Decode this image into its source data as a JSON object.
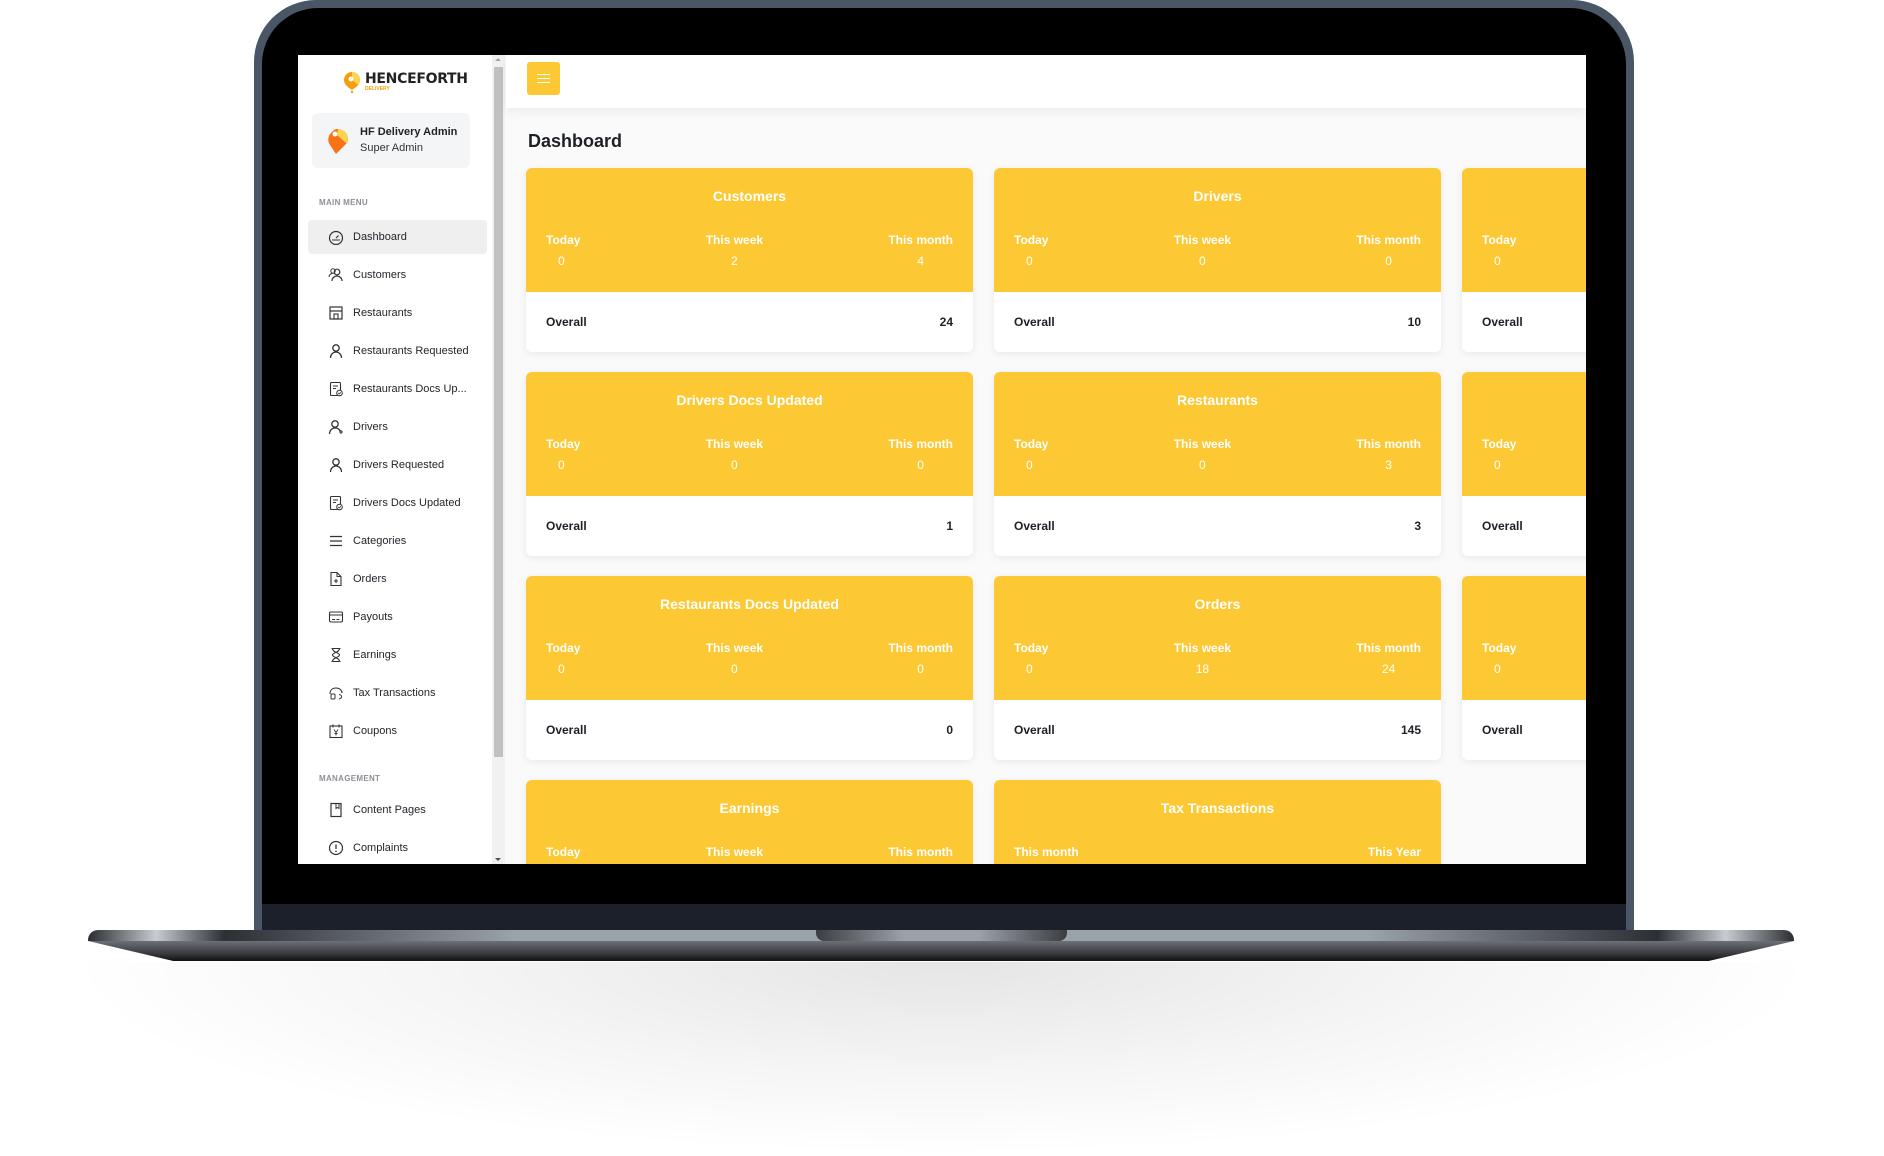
{
  "brand": {
    "name": "HENCEFORTH",
    "sub": "DELIVERY",
    "accent": "#fcc833"
  },
  "profile": {
    "name": "HF Delivery Admin",
    "role": "Super Admin"
  },
  "sidebar": {
    "main_menu_label": "MAIN MENU",
    "items": [
      {
        "label": "Dashboard",
        "icon": "dashboard-gauge-icon",
        "active": true
      },
      {
        "label": "Customers",
        "icon": "customers-icon"
      },
      {
        "label": "Restaurants",
        "icon": "store-icon"
      },
      {
        "label": "Restaurants Requested",
        "icon": "user-icon"
      },
      {
        "label": "Restaurants Docs Up...",
        "icon": "document-check-icon"
      },
      {
        "label": "Drivers",
        "icon": "user-add-icon"
      },
      {
        "label": "Drivers Requested",
        "icon": "user-icon"
      },
      {
        "label": "Drivers Docs Updated",
        "icon": "document-check-icon"
      },
      {
        "label": "Categories",
        "icon": "menu-lines-icon"
      },
      {
        "label": "Orders",
        "icon": "file-plus-icon"
      },
      {
        "label": "Payouts",
        "icon": "credit-card-icon"
      },
      {
        "label": "Earnings",
        "icon": "hourglass-icon"
      },
      {
        "label": "Tax Transactions",
        "icon": "tax-icon"
      },
      {
        "label": "Coupons",
        "icon": "coupon-icon"
      }
    ],
    "management_label": "MANAGEMENT",
    "management_items": [
      {
        "label": "Content Pages",
        "icon": "page-icon"
      },
      {
        "label": "Complaints",
        "icon": "alert-circle-icon"
      }
    ]
  },
  "header": {
    "menu_button": "hamburger-menu"
  },
  "page": {
    "title": "Dashboard"
  },
  "cards": [
    {
      "title": "Customers",
      "labels": [
        "Today",
        "This week",
        "This month"
      ],
      "values": [
        "0",
        "2",
        "4"
      ],
      "overall_label": "Overall",
      "overall": "24"
    },
    {
      "title": "Drivers",
      "labels": [
        "Today",
        "This week",
        "This month"
      ],
      "values": [
        "0",
        "0",
        "0"
      ],
      "overall_label": "Overall",
      "overall": "10"
    },
    {
      "title": "",
      "labels": [
        "Today"
      ],
      "values": [
        "0"
      ],
      "overall_label": "Overall",
      "overall": ""
    },
    {
      "title": "Drivers Docs Updated",
      "labels": [
        "Today",
        "This week",
        "This month"
      ],
      "values": [
        "0",
        "0",
        "0"
      ],
      "overall_label": "Overall",
      "overall": "1"
    },
    {
      "title": "Restaurants",
      "labels": [
        "Today",
        "This week",
        "This month"
      ],
      "values": [
        "0",
        "0",
        "3"
      ],
      "overall_label": "Overall",
      "overall": "3"
    },
    {
      "title": "",
      "labels": [
        "Today"
      ],
      "values": [
        "0"
      ],
      "overall_label": "Overall",
      "overall": ""
    },
    {
      "title": "Restaurants Docs Updated",
      "labels": [
        "Today",
        "This week",
        "This month"
      ],
      "values": [
        "0",
        "0",
        "0"
      ],
      "overall_label": "Overall",
      "overall": "0"
    },
    {
      "title": "Orders",
      "labels": [
        "Today",
        "This week",
        "This month"
      ],
      "values": [
        "0",
        "18",
        "24"
      ],
      "overall_label": "Overall",
      "overall": "145"
    },
    {
      "title": "",
      "labels": [
        "Today"
      ],
      "values": [
        "0"
      ],
      "overall_label": "Overall",
      "overall": ""
    },
    {
      "title": "Earnings",
      "labels": [
        "Today",
        "This week",
        "This month"
      ],
      "values": [],
      "overall_label": "",
      "overall": ""
    },
    {
      "title": "Tax Transactions",
      "labels": [
        "This month",
        "This Year"
      ],
      "values": [],
      "overall_label": "",
      "overall": ""
    }
  ]
}
